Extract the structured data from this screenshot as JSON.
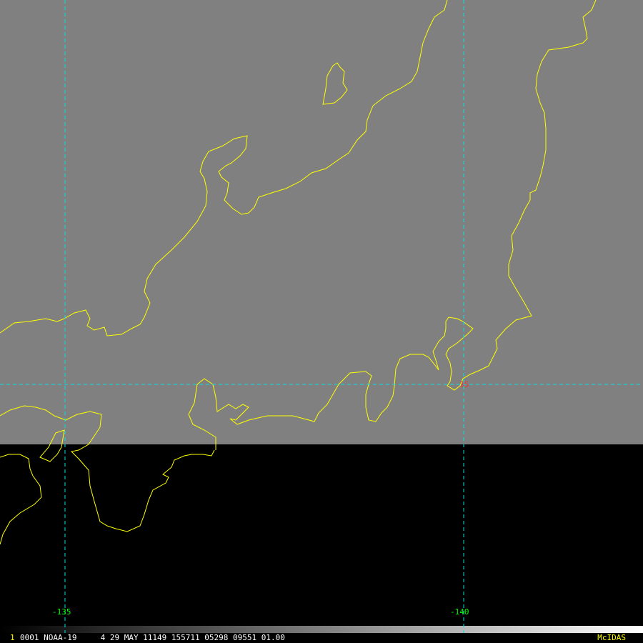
{
  "map": {
    "grid": {
      "longitudes": [
        {
          "label": "-135"
        },
        {
          "label": "-140"
        }
      ],
      "latitudes": [
        {
          "label": "35"
        }
      ]
    },
    "colors": {
      "scan_background": "#808080",
      "no_data": "#000000",
      "coastline": "#ffff00",
      "gridline": "#00e0e0",
      "longitude_label": "#00ff00",
      "latitude_label": "#ff3030"
    }
  },
  "status_bar": {
    "frame_number": "1",
    "text": "0001 NOAA-19     4 29 MAY 11149 155711 05298 09551 01.00",
    "brand": "McIDAS"
  },
  "colors": {
    "status_text": "#ffffff",
    "frame_number": "#ffff00",
    "brand": "#ffff00"
  }
}
